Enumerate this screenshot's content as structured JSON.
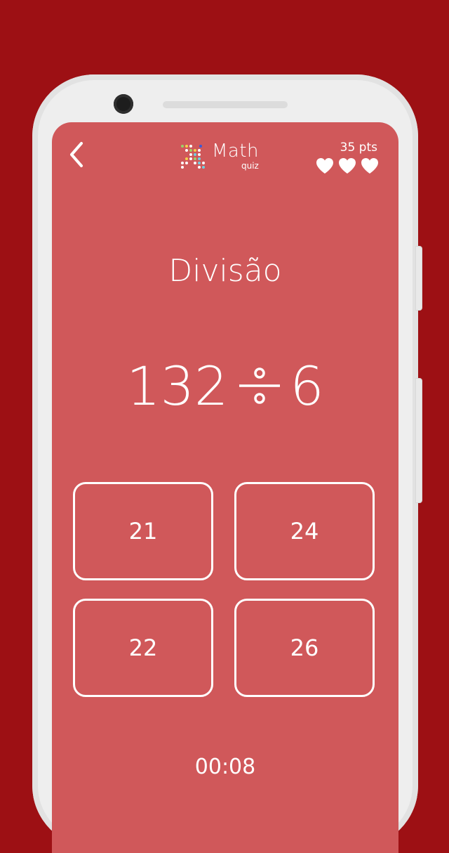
{
  "header": {
    "back_icon": "chevron-left-icon",
    "logo_title": "Math",
    "logo_subtitle": "quiz",
    "points": "35 pts",
    "lives": 3,
    "heart_icon": "heart-icon"
  },
  "quiz": {
    "operation": "Divisão",
    "operand_a": "132",
    "operator_icon": "division-icon",
    "operand_b": "6",
    "answers": [
      "21",
      "24",
      "22",
      "26"
    ],
    "timer": "00:08"
  },
  "colors": {
    "background": "#9d1014",
    "screen": "#d0585a",
    "text": "#ffffff"
  }
}
